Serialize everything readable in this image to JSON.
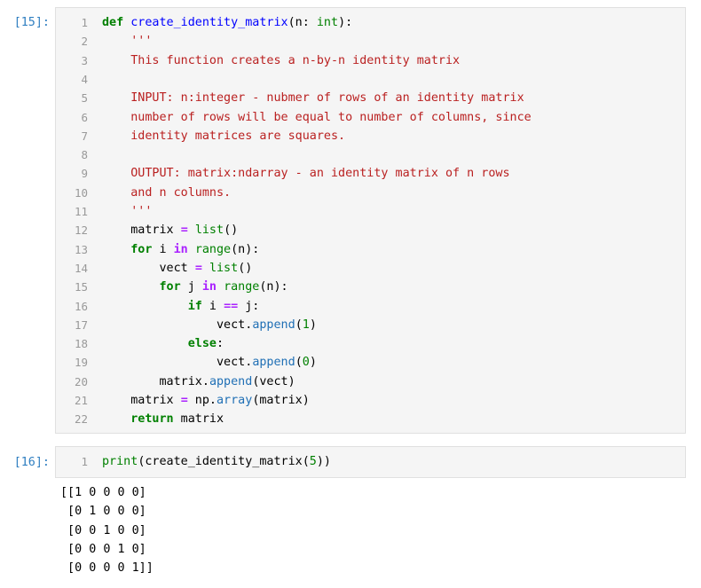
{
  "cells": [
    {
      "prompt": "[15]:",
      "lines": [
        {
          "n": "1",
          "tokens": [
            {
              "t": "def",
              "c": "kw"
            },
            {
              "t": " "
            },
            {
              "t": "create_identity_matrix",
              "c": "fn"
            },
            {
              "t": "(n: "
            },
            {
              "t": "int",
              "c": "bi"
            },
            {
              "t": "):"
            }
          ]
        },
        {
          "n": "2",
          "tokens": [
            {
              "t": "    "
            },
            {
              "t": "'''",
              "c": "str"
            }
          ]
        },
        {
          "n": "3",
          "tokens": [
            {
              "t": "    "
            },
            {
              "t": "This function creates a n-by-n identity matrix",
              "c": "str"
            }
          ]
        },
        {
          "n": "4",
          "tokens": []
        },
        {
          "n": "5",
          "tokens": [
            {
              "t": "    "
            },
            {
              "t": "INPUT: n:integer - nubmer of rows of an identity matrix",
              "c": "str"
            }
          ]
        },
        {
          "n": "6",
          "tokens": [
            {
              "t": "    "
            },
            {
              "t": "number of rows will be equal to number of columns, since",
              "c": "str"
            }
          ]
        },
        {
          "n": "7",
          "tokens": [
            {
              "t": "    "
            },
            {
              "t": "identity matrices are squares.",
              "c": "str"
            }
          ]
        },
        {
          "n": "8",
          "tokens": []
        },
        {
          "n": "9",
          "tokens": [
            {
              "t": "    "
            },
            {
              "t": "OUTPUT: matrix:ndarray - an identity matrix of n rows",
              "c": "str"
            }
          ]
        },
        {
          "n": "10",
          "tokens": [
            {
              "t": "    "
            },
            {
              "t": "and n columns.",
              "c": "str"
            }
          ]
        },
        {
          "n": "11",
          "tokens": [
            {
              "t": "    "
            },
            {
              "t": "'''",
              "c": "str"
            }
          ]
        },
        {
          "n": "12",
          "tokens": [
            {
              "t": "    matrix "
            },
            {
              "t": "=",
              "c": "op"
            },
            {
              "t": " "
            },
            {
              "t": "list",
              "c": "bi"
            },
            {
              "t": "()"
            }
          ]
        },
        {
          "n": "13",
          "tokens": [
            {
              "t": "    "
            },
            {
              "t": "for",
              "c": "kw"
            },
            {
              "t": " i "
            },
            {
              "t": "in",
              "c": "op"
            },
            {
              "t": " "
            },
            {
              "t": "range",
              "c": "bi"
            },
            {
              "t": "(n):"
            }
          ]
        },
        {
          "n": "14",
          "tokens": [
            {
              "t": "        vect "
            },
            {
              "t": "=",
              "c": "op"
            },
            {
              "t": " "
            },
            {
              "t": "list",
              "c": "bi"
            },
            {
              "t": "()"
            }
          ]
        },
        {
          "n": "15",
          "tokens": [
            {
              "t": "        "
            },
            {
              "t": "for",
              "c": "kw"
            },
            {
              "t": " j "
            },
            {
              "t": "in",
              "c": "op"
            },
            {
              "t": " "
            },
            {
              "t": "range",
              "c": "bi"
            },
            {
              "t": "(n):"
            }
          ]
        },
        {
          "n": "16",
          "tokens": [
            {
              "t": "            "
            },
            {
              "t": "if",
              "c": "kw"
            },
            {
              "t": " i "
            },
            {
              "t": "==",
              "c": "op"
            },
            {
              "t": " j:"
            }
          ]
        },
        {
          "n": "17",
          "tokens": [
            {
              "t": "                vect."
            },
            {
              "t": "append",
              "c": "attr"
            },
            {
              "t": "("
            },
            {
              "t": "1",
              "c": "num"
            },
            {
              "t": ")"
            }
          ]
        },
        {
          "n": "18",
          "tokens": [
            {
              "t": "            "
            },
            {
              "t": "else",
              "c": "kw"
            },
            {
              "t": ":"
            }
          ]
        },
        {
          "n": "19",
          "tokens": [
            {
              "t": "                vect."
            },
            {
              "t": "append",
              "c": "attr"
            },
            {
              "t": "("
            },
            {
              "t": "0",
              "c": "num"
            },
            {
              "t": ")"
            }
          ]
        },
        {
          "n": "20",
          "tokens": [
            {
              "t": "        matrix."
            },
            {
              "t": "append",
              "c": "attr"
            },
            {
              "t": "(vect)"
            }
          ]
        },
        {
          "n": "21",
          "tokens": [
            {
              "t": "    matrix "
            },
            {
              "t": "=",
              "c": "op"
            },
            {
              "t": " np."
            },
            {
              "t": "array",
              "c": "attr"
            },
            {
              "t": "(matrix)"
            }
          ]
        },
        {
          "n": "22",
          "tokens": [
            {
              "t": "    "
            },
            {
              "t": "return",
              "c": "kw"
            },
            {
              "t": " matrix"
            }
          ]
        }
      ]
    },
    {
      "prompt": "[16]:",
      "lines": [
        {
          "n": "1",
          "tokens": [
            {
              "t": "print",
              "c": "bi"
            },
            {
              "t": "(create_identity_matrix("
            },
            {
              "t": "5",
              "c": "num"
            },
            {
              "t": "))"
            }
          ]
        }
      ]
    }
  ],
  "output": [
    "[[1 0 0 0 0]",
    " [0 1 0 0 0]",
    " [0 0 1 0 0]",
    " [0 0 0 1 0]",
    " [0 0 0 0 1]]"
  ]
}
